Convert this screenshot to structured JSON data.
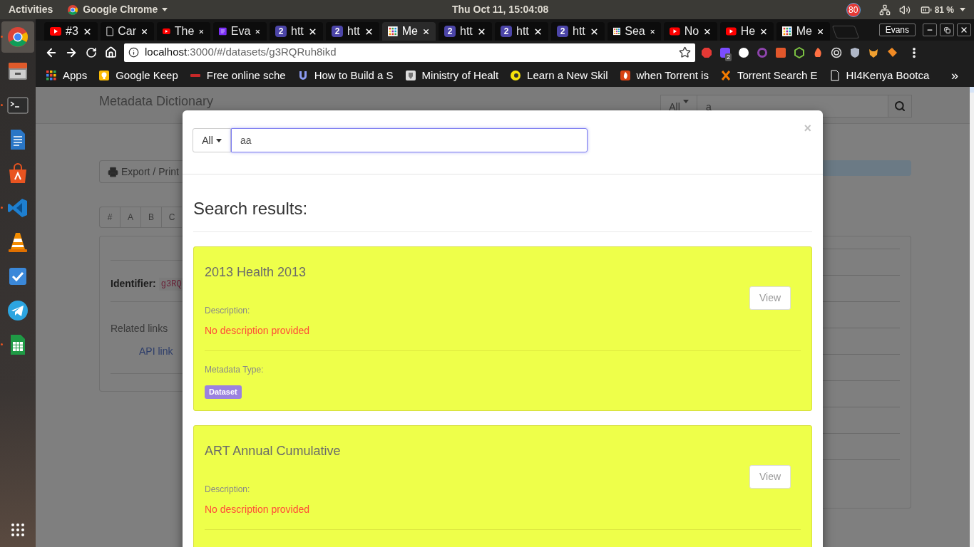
{
  "top_bar": {
    "activities": "Activities",
    "app_name": "Google Chrome",
    "clock": "Thu Oct 11, 15:04:08",
    "notification_count": "80",
    "battery": "81 %"
  },
  "dock": [
    {
      "kind": "chrome",
      "selected": true,
      "running": true
    },
    {
      "kind": "files",
      "selected": false,
      "running": false
    },
    {
      "kind": "terminal",
      "selected": false,
      "running": true
    },
    {
      "kind": "writer",
      "selected": false,
      "running": false
    },
    {
      "kind": "software",
      "selected": false,
      "running": false
    },
    {
      "kind": "vscode",
      "selected": false,
      "running": true
    },
    {
      "kind": "vlc",
      "selected": false,
      "running": false
    },
    {
      "kind": "tasks",
      "selected": false,
      "running": false
    },
    {
      "kind": "telegram",
      "selected": false,
      "running": false
    },
    {
      "kind": "calc",
      "selected": false,
      "running": true
    }
  ],
  "browser": {
    "tabs": [
      {
        "kind": "youtube",
        "label": "#3",
        "selected": false
      },
      {
        "kind": "doc",
        "label": "Car",
        "selected": false
      },
      {
        "kind": "youtube",
        "label": "The",
        "selected": false
      },
      {
        "kind": "lines",
        "label": "Eva",
        "selected": false
      },
      {
        "kind": "badge",
        "icon_text": "2",
        "label": "htt",
        "selected": false
      },
      {
        "kind": "badge",
        "icon_text": "2",
        "label": "htt",
        "selected": false
      },
      {
        "kind": "grid",
        "label": "Me",
        "selected": true
      },
      {
        "kind": "badge",
        "icon_text": "2",
        "label": "htt",
        "selected": false
      },
      {
        "kind": "badge",
        "icon_text": "2",
        "label": "htt",
        "selected": false
      },
      {
        "kind": "badge",
        "icon_text": "2",
        "label": "htt",
        "selected": false
      },
      {
        "kind": "grid",
        "label": "Sea",
        "selected": false
      },
      {
        "kind": "youtube",
        "label": "No",
        "selected": false
      },
      {
        "kind": "youtube",
        "label": "He",
        "selected": false
      },
      {
        "kind": "grid",
        "label": "Me",
        "selected": false
      }
    ],
    "profile": "Evans",
    "url_host": "localhost",
    "url_path": ":3000/#/datasets/g3RQRuh8ikd",
    "extension_badge": "2",
    "bookmarks": [
      {
        "kind": "apps",
        "label": "Apps"
      },
      {
        "kind": "keep",
        "label": "Google Keep"
      },
      {
        "kind": "sbd",
        "label": "Free online sche"
      },
      {
        "kind": "udemy",
        "label": "How to Build a S"
      },
      {
        "kind": "crest",
        "label": "Ministry of Healt"
      },
      {
        "kind": "learn",
        "label": "Learn a New Skil"
      },
      {
        "kind": "torrent",
        "label": "when Torrent is"
      },
      {
        "kind": "cross",
        "label": "Torrent Search E"
      },
      {
        "kind": "page",
        "label": "HI4Kenya Bootca"
      }
    ],
    "more_bookmarks": "»"
  },
  "page": {
    "navbar": {
      "title": "Metadata Dictionary",
      "filter": "All",
      "query": "a"
    },
    "export_button": "Export / Print",
    "alphabet": [
      "#",
      "A",
      "B",
      "C"
    ],
    "identifier_label": "Identifier:",
    "identifier_value": "g3RQ",
    "related_links": "Related links",
    "api_link": "API link"
  },
  "modal": {
    "filter": "All",
    "query": "aa",
    "close": "×",
    "heading": "Search results:",
    "results": [
      {
        "title": "2013 Health 2013",
        "view": "View",
        "description_label": "Description:",
        "description": "No description provided",
        "type_label": "Metadata Type:",
        "type": "Dataset"
      },
      {
        "title": "ART Annual Cumulative",
        "view": "View",
        "description_label": "Description:",
        "description": "No description provided"
      }
    ]
  }
}
